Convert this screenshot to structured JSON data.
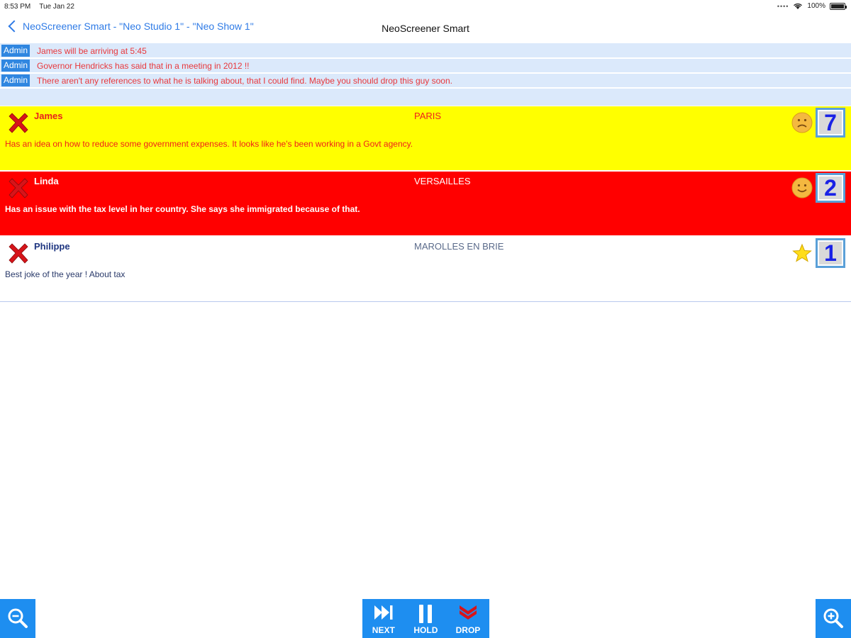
{
  "status_bar": {
    "time": "8:53 PM",
    "date": "Tue Jan 22",
    "battery": "100%"
  },
  "nav": {
    "back_label": "NeoScreener Smart - \"Neo Studio 1\" - \"Neo Show 1\"",
    "title": "NeoScreener Smart"
  },
  "admin_messages": [
    {
      "badge": "Admin",
      "text": "James will be arriving at 5:45"
    },
    {
      "badge": "Admin",
      "text": "Governor Hendricks has said that in a meeting in 2012 !!"
    },
    {
      "badge": "Admin",
      "text": "There aren't any references to what he is talking about, that I could find. Maybe you should drop this guy soon."
    }
  ],
  "callers": [
    {
      "name": "James",
      "city": "PARIS",
      "topic": "Has an idea on how to reduce some government expenses. It looks like he's been working in a Govt agency.",
      "mood_icon": "sad-face-icon",
      "line": "7",
      "row_color": "#ffff00"
    },
    {
      "name": "Linda",
      "city": "VERSAILLES",
      "topic": "Has an issue with the tax level in her country. She says she immigrated because of that.",
      "mood_icon": "happy-face-icon",
      "line": "2",
      "row_color": "#ff0000"
    },
    {
      "name": "Philippe",
      "city": "MAROLLES EN BRIE",
      "topic": "Best joke of the year ! About tax",
      "mood_icon": "star-icon",
      "line": "1",
      "row_color": "#ffffff"
    }
  ],
  "toolbar": {
    "next_label": "NEXT",
    "hold_label": "HOLD",
    "drop_label": "DROP",
    "zoom_out_icon": "zoom-out-icon",
    "zoom_in_icon": "zoom-in-icon",
    "accent_color": "#1e8ef0"
  }
}
